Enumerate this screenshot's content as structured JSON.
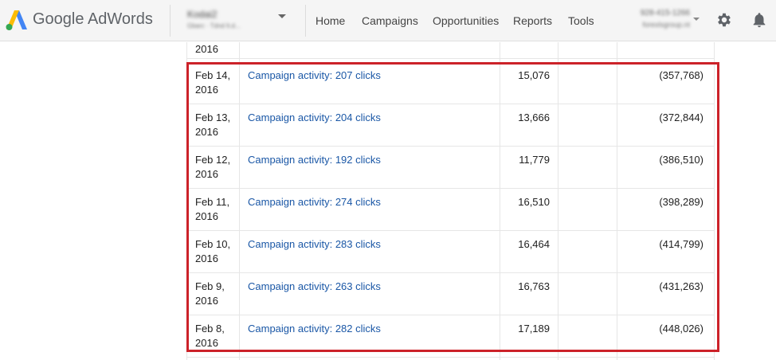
{
  "header": {
    "brand": "Google AdWords",
    "account_name": "Kodai2",
    "account_sub": "Gbarc · Tdnd lt.d...",
    "nav": [
      "Home",
      "Campaigns",
      "Opportunities",
      "Reports",
      "Tools"
    ],
    "user_line1": "928-415-1266",
    "user_line2": "forexlsgroup.nt",
    "colors": {
      "bar_bg": "#f5f5f5",
      "link": "#1a57a6",
      "highlight": "#cc2229"
    },
    "icons": [
      "adwords-logo-icon",
      "chevron-down-icon",
      "gear-icon",
      "bell-icon"
    ]
  },
  "table": {
    "partial_row": {
      "date_tail": "2016"
    },
    "rows": [
      {
        "date_line1": "Feb 14,",
        "date_line2": "2016",
        "description": "Campaign activity: 207 clicks",
        "amount": "15,076",
        "balance": "(357,768)"
      },
      {
        "date_line1": "Feb 13,",
        "date_line2": "2016",
        "description": "Campaign activity: 204 clicks",
        "amount": "13,666",
        "balance": "(372,844)"
      },
      {
        "date_line1": "Feb 12,",
        "date_line2": "2016",
        "description": "Campaign activity: 192 clicks",
        "amount": "11,779",
        "balance": "(386,510)"
      },
      {
        "date_line1": "Feb 11,",
        "date_line2": "2016",
        "description": "Campaign activity: 274 clicks",
        "amount": "16,510",
        "balance": "(398,289)"
      },
      {
        "date_line1": "Feb 10,",
        "date_line2": "2016",
        "description": "Campaign activity: 283 clicks",
        "amount": "16,464",
        "balance": "(414,799)"
      },
      {
        "date_line1": "Feb 9,",
        "date_line2": "2016",
        "description": "Campaign activity: 263 clicks",
        "amount": "16,763",
        "balance": "(431,263)"
      },
      {
        "date_line1": "Feb 8,",
        "date_line2": "2016",
        "description": "Campaign activity: 282 clicks",
        "amount": "17,189",
        "balance": "(448,026)"
      }
    ]
  }
}
